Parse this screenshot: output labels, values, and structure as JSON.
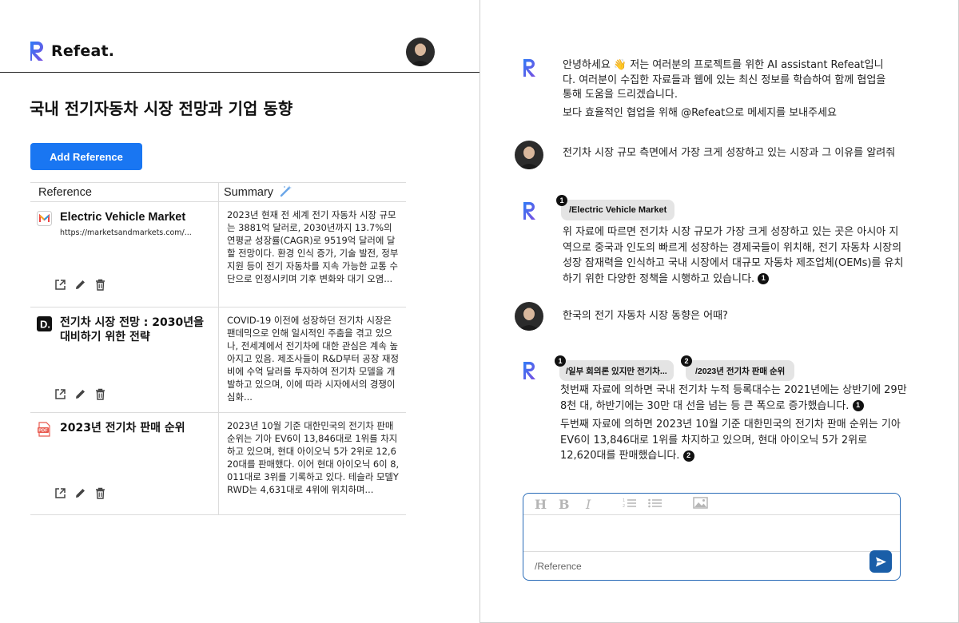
{
  "brand": {
    "name": "Refeat."
  },
  "page": {
    "title": "국내 전기자동차 시장 전망과 기업 동향"
  },
  "references": {
    "add_button": "Add Reference",
    "columns": [
      "Reference",
      "Summary"
    ],
    "rows": [
      {
        "icon": "markets-logo-icon",
        "title": "Electric Vehicle Market",
        "url": "https://marketsandmarkets.com/...",
        "summary": "2023년 현재 전 세계 전기 자동차 시장 규모는 3881억 달러로, 2030년까지 13.7%의 연평균 성장률(CAGR)로 9519억 달러에 달할 전망이다. 환경 인식 증가, 기술 발전, 정부 지원 등이 전기 자동차를 지속 가능한 교통 수단으로 인정시키며 기후 변화와 대기 오염..."
      },
      {
        "icon": "d-logo-icon",
        "title": "전기차 시장 전망 : 2030년을 대비하기 위한 전략",
        "url": "",
        "summary": "COVID-19 이전에 성장하던 전기차 시장은 팬데믹으로 인해 일시적인 주춤을 겪고 있으나, 전세계에서 전기차에 대한 관심은 계속 높아지고 있음. 제조사들이 R&D부터 공장 재정비에 수억 달러를 투자하여 전기차 모델을 개발하고 있으며, 이에 따라 시자에서의 경쟁이 심화..."
      },
      {
        "icon": "pdf-icon",
        "title": "2023년 전기차 판매 순위",
        "url": "",
        "summary": "2023년 10월 기준 대한민국의 전기차 판매 순위는 기아 EV6이 13,846대로 1위를 차지하고 있으며, 현대 아이오닉 5가 2위로 12,620대를 판매했다. 이어 현대 아이오닉 6이 8,011대로 3위를 기록하고 있다. 테슬라 모델Y RWD는 4,631대로 4위에 위치하며..."
      }
    ]
  },
  "chat": {
    "greeting_1": "안녕하세요 👋 저는 여러분의 프로젝트를 위한 AI assistant Refeat입니다. 여러분이 수집한 자료들과 웹에 있는 최신 정보를 학습하여 함께 협업을 통해 도움을 드리겠습니다.",
    "greeting_2": "보다 효율적인 협업을 위해 @Refeat으로 메세지를 보내주세요",
    "user_q1": "전기차 시장 규모 측면에서 가장 크게 성장하고 있는 시장과 그 이유를 알려줘",
    "answer1_chip": "/Electric Vehicle Market",
    "answer1_chip_num": "1",
    "answer1_text": "위 자료에 따르면 전기차 시장 규모가 가장 크게 성장하고 있는 곳은 아시아 지역으로 중국과 인도의 빠르게 성장하는 경제국들이 위치해, 전기 자동차 시장의 성장 잠재력을 인식하고 국내 시장에서 대규모 자동차 제조업체(OEMs)를 유치하기 위한 다양한 정책을 시행하고 있습니다.",
    "answer1_cite": "1",
    "user_q2": "한국의 전기 자동차 시장 동향은 어때?",
    "answer2_chip1": "/일부 회의론 있지만 전기차...",
    "answer2_chip1_num": "1",
    "answer2_chip2": "/2023년 전기차 판매 순위",
    "answer2_chip2_num": "2",
    "answer2_text1": "첫번째 자료에 의하면 국내 전기차 누적 등록대수는 2021년에는 상반기에 29만8천 대, 하반기에는 30만 대 선을 넘는 등 큰 폭으로 증가했습니다.",
    "answer2_cite1": "1",
    "answer2_text2": "두번째 자료에 의하면 2023년 10월 기준 대한민국의 전기차 판매 순위는 기아 EV6이 13,846대로 1위를 차지하고 있으며, 현대 아이오닉 5가 2위로 12,620대를 판매했습니다.",
    "answer2_cite2": "2"
  },
  "composer": {
    "toolbar": [
      "H",
      "B",
      "I",
      "ordered-list-icon",
      "bullet-list-icon",
      "image-icon"
    ],
    "placeholder": "/Reference",
    "send_icon": "send-icon"
  },
  "colors": {
    "accent": "#1976f2",
    "send": "#1a5ea8",
    "composer_border": "#2a6cb8"
  }
}
